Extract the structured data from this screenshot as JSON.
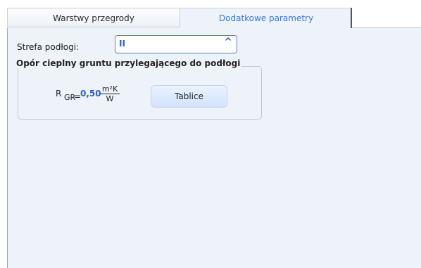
{
  "tabs": [
    {
      "label": "Warstwy przegrody",
      "active": false
    },
    {
      "label": "Dodatkowe parametry",
      "active": true
    }
  ],
  "zone": {
    "label": "Strefa podłogi:",
    "value": "II"
  },
  "ground_resistance": {
    "legend": "Opór cieplny gruntu przylegającego do podłogi",
    "symbol": "R",
    "subscript": "GR",
    "equals": "=",
    "value": "0,50",
    "unit_numerator": "m²K",
    "unit_denominator": "W",
    "button_label": "Tablice"
  },
  "colors": {
    "accent": "#2d5fd0",
    "panel_bg": "#eef3fa"
  }
}
